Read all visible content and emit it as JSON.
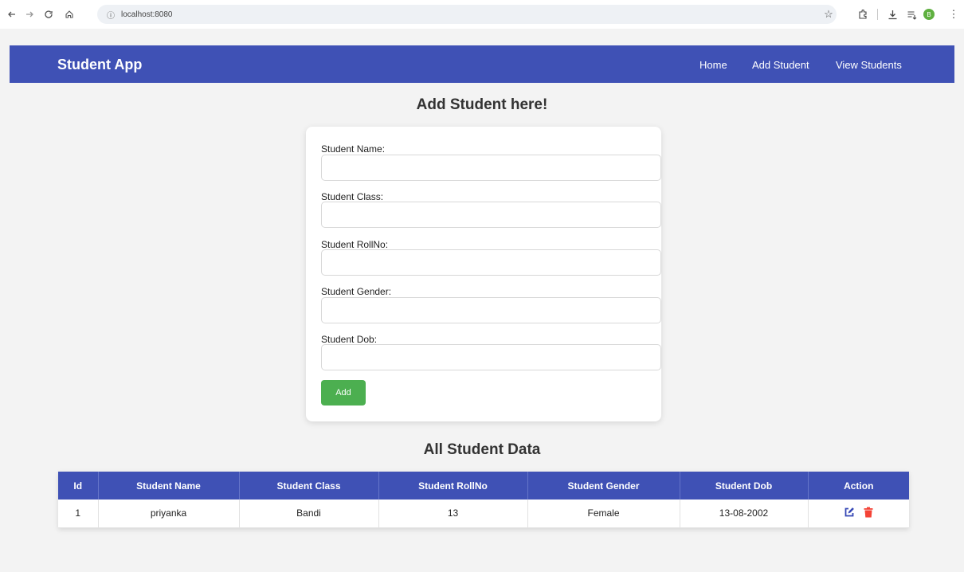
{
  "browser": {
    "url": "localhost:8080",
    "profile_initial": "B"
  },
  "navbar": {
    "brand": "Student App",
    "links": [
      "Home",
      "Add Student",
      "View Students"
    ]
  },
  "form": {
    "title": "Add Student here!",
    "fields": [
      {
        "label": "Student Name:",
        "value": ""
      },
      {
        "label": "Student Class:",
        "value": ""
      },
      {
        "label": "Student RollNo:",
        "value": ""
      },
      {
        "label": "Student Gender:",
        "value": ""
      },
      {
        "label": "Student Dob:",
        "value": ""
      }
    ],
    "submit_label": "Add"
  },
  "table": {
    "title": "All Student Data",
    "columns": [
      "Id",
      "Student Name",
      "Student Class",
      "Student RollNo",
      "Student Gender",
      "Student Dob",
      "Action"
    ],
    "rows": [
      [
        "1",
        "priyanka",
        "Bandi",
        "13",
        "Female",
        "13-08-2002"
      ]
    ]
  },
  "colors": {
    "primary": "#3f51b5",
    "success": "#4caf50",
    "edit_icon": "#3547b5",
    "delete_icon": "#f44336"
  }
}
